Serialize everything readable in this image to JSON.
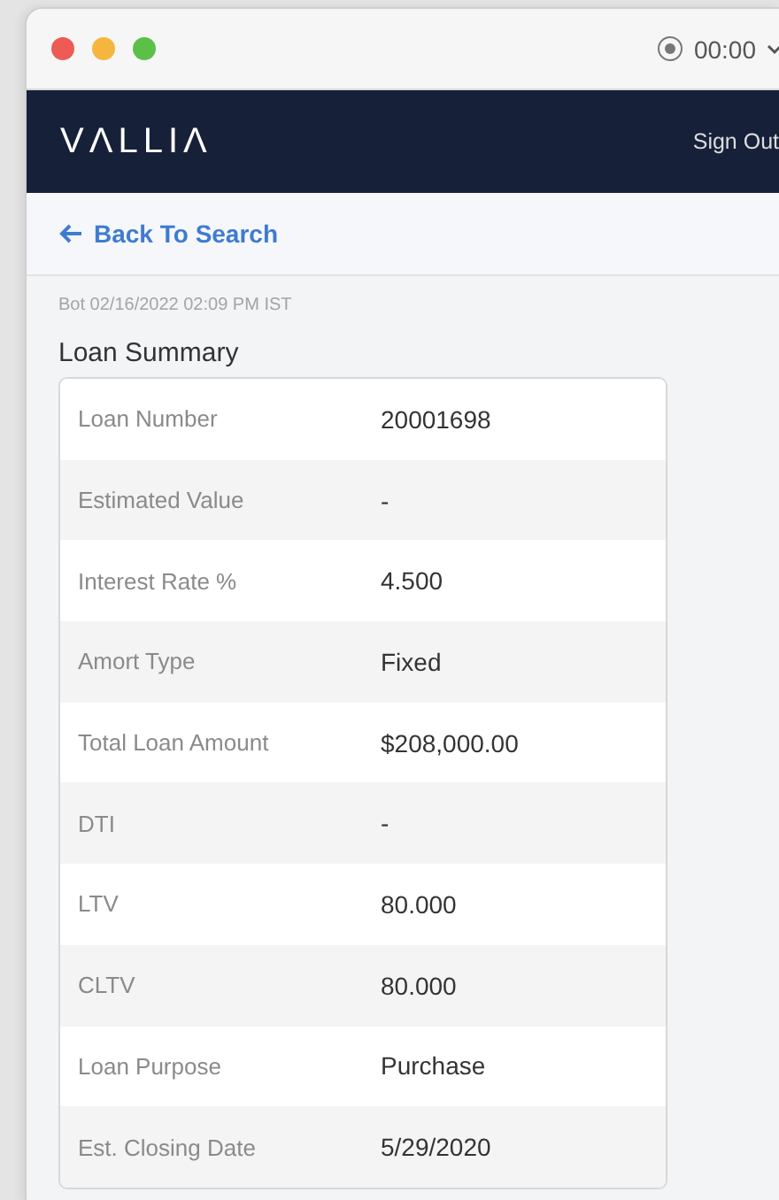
{
  "window": {
    "timer": "00:00"
  },
  "header": {
    "logo": "VΛLLIΛ",
    "sign_out": "Sign Out"
  },
  "back_link": {
    "label": "Back To Search"
  },
  "timestamp": "Bot 02/16/2022 02:09 PM IST",
  "section_title": "Loan Summary",
  "rows": [
    {
      "label": "Loan Number",
      "value": "20001698"
    },
    {
      "label": "Estimated Value",
      "value": "-"
    },
    {
      "label": "Interest Rate %",
      "value": "4.500"
    },
    {
      "label": "Amort Type",
      "value": "Fixed"
    },
    {
      "label": "Total Loan Amount",
      "value": "$208,000.00"
    },
    {
      "label": "DTI",
      "value": "-"
    },
    {
      "label": "LTV",
      "value": "80.000"
    },
    {
      "label": "CLTV",
      "value": "80.000"
    },
    {
      "label": "Loan Purpose",
      "value": "Purchase"
    },
    {
      "label": "Est. Closing Date",
      "value": "5/29/2020"
    }
  ]
}
